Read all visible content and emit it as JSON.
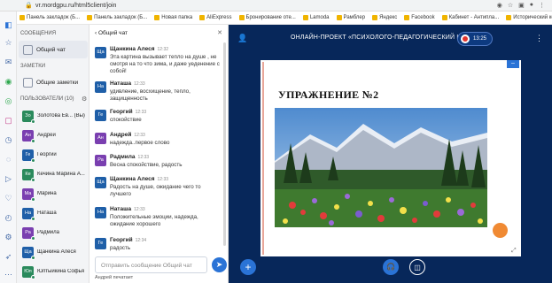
{
  "browser": {
    "url": "vr.mordgpu.ru/html5client/join",
    "bookmarks": [
      "Панель закладок (Б...",
      "Панель закладок (Б...",
      "Новая папка",
      "AliExpress",
      "Бронирование оте...",
      "Lamoda",
      "Рамблер",
      "Яндекс",
      "Facebook",
      "Кабинет - Антипла...",
      "Исторический кон..."
    ]
  },
  "sidebar": {
    "messages_header": "СООБЩЕНИЯ",
    "public_chat": "Общий чат",
    "notes_header": "ЗАМЕТКИ",
    "shared_notes": "Общие заметки",
    "users_header": "ПОЛЬЗОВАТЕЛИ (10)",
    "users": [
      {
        "initials": "Зо",
        "name": "Золотова Ев... (Вы)",
        "color": "#2a8a5c"
      },
      {
        "initials": "Ан",
        "name": "Андрей",
        "color": "#7a3fb0"
      },
      {
        "initials": "Ге",
        "name": "Георгий",
        "color": "#1f5fa8"
      },
      {
        "initials": "Ке",
        "name": "Кечина Марина А...",
        "color": "#2a8a5c"
      },
      {
        "initials": "Ма",
        "name": "Марина",
        "color": "#7a3fb0"
      },
      {
        "initials": "На",
        "name": "Наташа",
        "color": "#1f5fa8"
      },
      {
        "initials": "Ра",
        "name": "Радмила",
        "color": "#7a3fb0"
      },
      {
        "initials": "Ща",
        "name": "Щанкина Алеся",
        "color": "#1f5fa8"
      },
      {
        "initials": "Юл",
        "name": "Юлтыйкина Софья",
        "color": "#2a8a5c"
      }
    ]
  },
  "chat": {
    "header": "Общий чат",
    "messages": [
      {
        "initials": "Ща",
        "color": "#1f5fa8",
        "author": "Щанкина Алеся",
        "time": "12:32",
        "text": "Эта картина вызывает тепло на душе , не смотря на то что зима, и даже уеденение с собой!"
      },
      {
        "initials": "На",
        "color": "#1f5fa8",
        "author": "Наташа",
        "time": "12:33",
        "text": "удивление, восхищение, тепло, защищенность"
      },
      {
        "initials": "Ге",
        "color": "#1f5fa8",
        "author": "Георгий",
        "time": "12:33",
        "text": "спокойствие"
      },
      {
        "initials": "Ан",
        "color": "#7a3fb0",
        "author": "Андрей",
        "time": "12:33",
        "text": "надежда..первое слово"
      },
      {
        "initials": "Ра",
        "color": "#7a3fb0",
        "author": "Радмила",
        "time": "12:33",
        "text": "Весна спокойствие, радость"
      },
      {
        "initials": "Ща",
        "color": "#1f5fa8",
        "author": "Щанкина Алеся",
        "time": "12:33",
        "text": "Радость на душе, ожидание чего то лучшего"
      },
      {
        "initials": "На",
        "color": "#1f5fa8",
        "author": "Наташа",
        "time": "12:33",
        "text": "Положительные эмоции, надежда, ожидание хорошего"
      },
      {
        "initials": "Ге",
        "color": "#1f5fa8",
        "author": "Георгий",
        "time": "12:34",
        "text": "радость"
      }
    ],
    "input_placeholder": "Отправить сообщение Общий чат",
    "typing": "Андрей печатает"
  },
  "main": {
    "title": "ОНЛАЙН-ПРОЕКТ «ПСИХОЛОГО-ПЕДАГОГИЧЕСКИЙ КЛА...",
    "recording_time": "13:25",
    "slide_title": "УПРАЖНЕНИЕ №2"
  },
  "colors": {
    "accent": "#2a73d6",
    "main_bg": "#07275a",
    "record": "#e2352e",
    "orange": "#f08a33"
  }
}
